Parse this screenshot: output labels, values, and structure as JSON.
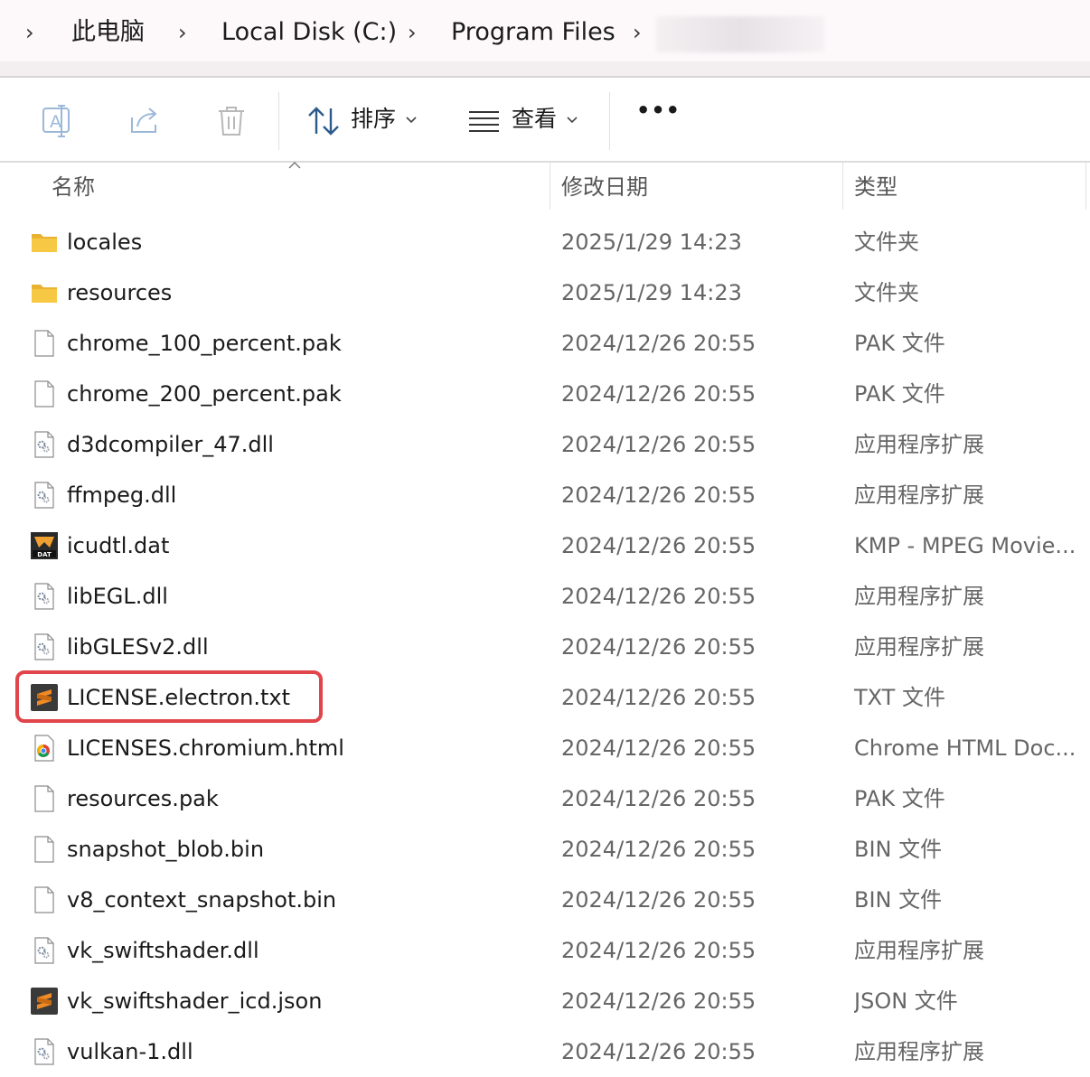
{
  "breadcrumb": {
    "items": [
      "此电脑",
      "Local Disk (C:)",
      "Program Files"
    ],
    "separator": "›"
  },
  "toolbar": {
    "sort_label": "排序",
    "view_label": "查看",
    "more_label": "•••"
  },
  "columns": {
    "name": "名称",
    "modified": "修改日期",
    "type": "类型"
  },
  "files": [
    {
      "name": "locales",
      "date": "2025/1/29 14:23",
      "type": "文件夹",
      "icon": "folder-icon"
    },
    {
      "name": "resources",
      "date": "2025/1/29 14:23",
      "type": "文件夹",
      "icon": "folder-icon"
    },
    {
      "name": "chrome_100_percent.pak",
      "date": "2024/12/26 20:55",
      "type": "PAK 文件",
      "icon": "file-icon"
    },
    {
      "name": "chrome_200_percent.pak",
      "date": "2024/12/26 20:55",
      "type": "PAK 文件",
      "icon": "file-icon"
    },
    {
      "name": "d3dcompiler_47.dll",
      "date": "2024/12/26 20:55",
      "type": "应用程序扩展",
      "icon": "dll-icon"
    },
    {
      "name": "ffmpeg.dll",
      "date": "2024/12/26 20:55",
      "type": "应用程序扩展",
      "icon": "dll-icon"
    },
    {
      "name": "icudtl.dat",
      "date": "2024/12/26 20:55",
      "type": "KMP - MPEG Movie...",
      "icon": "dat-icon"
    },
    {
      "name": "libEGL.dll",
      "date": "2024/12/26 20:55",
      "type": "应用程序扩展",
      "icon": "dll-icon"
    },
    {
      "name": "libGLESv2.dll",
      "date": "2024/12/26 20:55",
      "type": "应用程序扩展",
      "icon": "dll-icon"
    },
    {
      "name": "LICENSE.electron.txt",
      "date": "2024/12/26 20:55",
      "type": "TXT 文件",
      "icon": "sublime-icon"
    },
    {
      "name": "LICENSES.chromium.html",
      "date": "2024/12/26 20:55",
      "type": "Chrome HTML Doc...",
      "icon": "chrome-icon"
    },
    {
      "name": "resources.pak",
      "date": "2024/12/26 20:55",
      "type": "PAK 文件",
      "icon": "file-icon"
    },
    {
      "name": "snapshot_blob.bin",
      "date": "2024/12/26 20:55",
      "type": "BIN 文件",
      "icon": "file-icon"
    },
    {
      "name": "v8_context_snapshot.bin",
      "date": "2024/12/26 20:55",
      "type": "BIN 文件",
      "icon": "file-icon"
    },
    {
      "name": "vk_swiftshader.dll",
      "date": "2024/12/26 20:55",
      "type": "应用程序扩展",
      "icon": "dll-icon"
    },
    {
      "name": "vk_swiftshader_icd.json",
      "date": "2024/12/26 20:55",
      "type": "JSON 文件",
      "icon": "sublime-icon"
    },
    {
      "name": "vulkan-1.dll",
      "date": "2024/12/26 20:55",
      "type": "应用程序扩展",
      "icon": "dll-icon"
    }
  ],
  "colors": {
    "highlight_border": "#e0454b",
    "folder_yellow": "#f7c843",
    "sublime_orange": "#f08a24"
  }
}
